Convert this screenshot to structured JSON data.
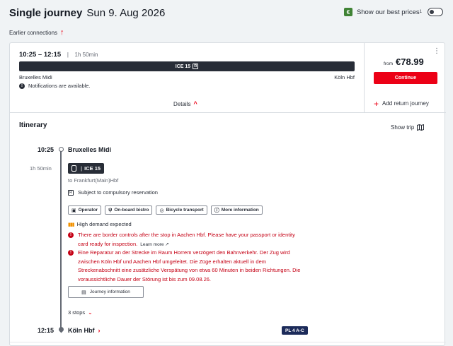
{
  "header": {
    "title": "Single journey",
    "date": "Sun 9. Aug 2026",
    "best_prices_label": "Show our best prices",
    "best_prices_sup": "1",
    "euro_symbol": "€"
  },
  "earlier_connections": "Earlier connections",
  "connection": {
    "time_range": "10:25 – 12:15",
    "separator": "|",
    "duration": "1h 50min",
    "train_label": "ICE 15",
    "reservation_symbol": "R",
    "origin": "Bruxelles Midi",
    "destination": "Köln Hbf",
    "notification": "Notifications are available.",
    "details_label": "Details",
    "menu_dots": "⋮",
    "price_from": "from",
    "price": "€78.99",
    "continue_label": "Continue",
    "add_return_label": "Add return journey"
  },
  "itinerary": {
    "title": "Itinerary",
    "show_trip_label": "Show trip",
    "departure_time": "10:25",
    "departure_station": "Bruxelles Midi",
    "duration": "1h 50min",
    "train": "ICE 15",
    "direction": "to Frankfurt(Main)Hbf",
    "reservation_note": "Subject to compulsory reservation",
    "chips": [
      "Operator",
      "On-board bistro",
      "Bicycle transport",
      "More information"
    ],
    "demand": "High demand expected",
    "warnings": [
      "There are border controls after the stop in Aachen Hbf. Please have your passport or identity card ready for inspection.",
      "Eine Reparatur an der Strecke im Raum Horrem verzögert den Bahnverkehr. Der Zug wird zwischen Köln Hbf und Aachen Hbf umgeleitet. Die Züge erhalten aktuell in dem Streckenabschnitt eine zusätzliche Verspätung von etwa 60 Minuten in beiden Richtungen. Die voraussichtliche Dauer der Störung ist bis zum 09.08.26."
    ],
    "learn_more": "Learn more",
    "journey_info_label": "Journey information",
    "stops_label": "3 stops",
    "arrival_time": "12:15",
    "arrival_station": "Köln Hbf",
    "platform": "PL 4 A-C"
  },
  "colors": {
    "accent": "#ec0016",
    "warning": "#c50014",
    "dark": "#282d37",
    "platform": "#1c2b5a",
    "euro_green": "#408335"
  }
}
